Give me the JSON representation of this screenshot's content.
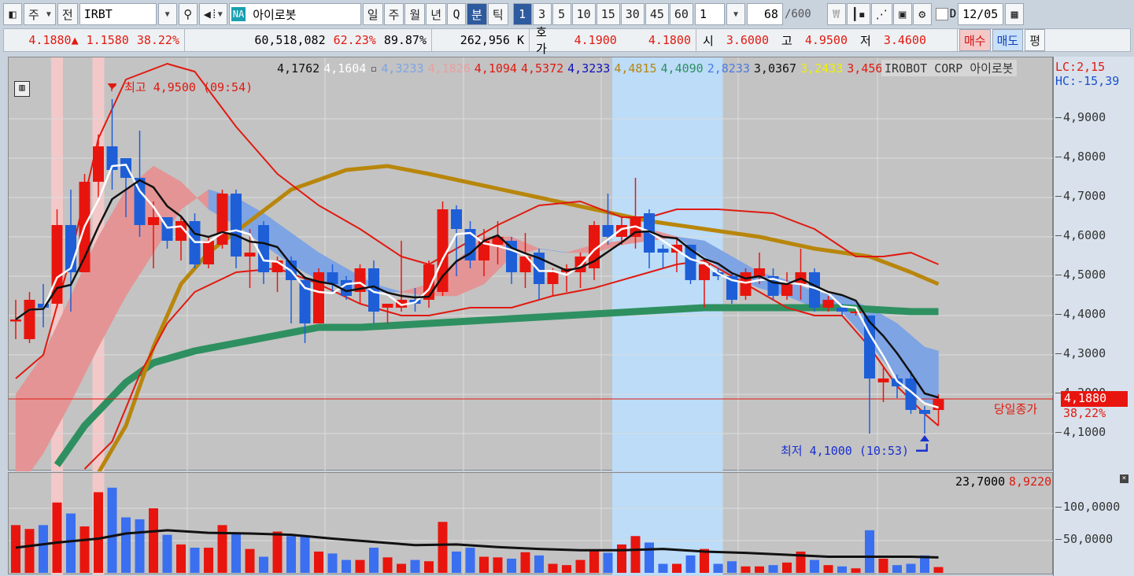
{
  "toolbar": {
    "period_type": "주",
    "jeon": "전",
    "symbol": "IRBT",
    "na_badge": "NA",
    "name": "아이로봇",
    "periods": [
      "일",
      "주",
      "월",
      "년",
      "Q",
      "분",
      "틱"
    ],
    "active_period": "분",
    "intervals": [
      "1",
      "3",
      "5",
      "10",
      "15",
      "30",
      "45",
      "60"
    ],
    "active_interval": "1",
    "custom_interval": "1",
    "count": "68",
    "count_max": "/600",
    "d_label": "D",
    "date": "12/05"
  },
  "quote": {
    "price": "4.1880▲",
    "change": "1.1580",
    "change_pct": "38.22%",
    "volume": "60,518,082",
    "vol_pct1": "62.23%",
    "vol_pct2": "89.87%",
    "amount": "262,956 K",
    "hoga_label": "호가",
    "ask": "4.1900",
    "bid": "4.1800",
    "open_label": "시",
    "open": "3.6000",
    "high_label": "고",
    "high": "4.9500",
    "low_label": "저",
    "low": "3.4600",
    "buy": "매수",
    "sell": "매도",
    "avg": "평"
  },
  "legend": [
    {
      "t": "4,1762",
      "c": "#111111"
    },
    {
      "t": "4,1604",
      "c": "#ffffff"
    },
    {
      "t": "▫",
      "c": "#555555"
    },
    {
      "t": "4,3233",
      "c": "#7ea4e4"
    },
    {
      "t": "4,1826",
      "c": "#e8a0a0"
    },
    {
      "t": "4,1094",
      "c": "#e01a10"
    },
    {
      "t": "4,5372",
      "c": "#e01a10"
    },
    {
      "t": "4,3233",
      "c": "#1010c0"
    },
    {
      "t": "4,4815",
      "c": "#b8860b"
    },
    {
      "t": "4,4090",
      "c": "#2e9060"
    },
    {
      "t": "2,8233",
      "c": "#4a7ae0"
    },
    {
      "t": "3,0367",
      "c": "#111111"
    },
    {
      "t": "3,2433",
      "c": "#f0f000"
    },
    {
      "t": "3,4567",
      "c": "#e01a10"
    },
    {
      "t": "▫",
      "c": "#555555"
    }
  ],
  "legend_name": "IROBOT CORP  아이로봇",
  "lc": "LC:2,15",
  "hc": "HC:-15,39",
  "close_label": "당일종가",
  "close_value": "4,1880",
  "close_pct": "38,22%",
  "high_marker": "최고 4,9500 (09:54)",
  "low_marker": "최저 4,1000 (10:53)",
  "vol_legend": {
    "a": "23,7000",
    "b": "8,9220"
  },
  "colors": {
    "up": "#e8150e",
    "down": "#1e5fd8",
    "vol_down": "#3a6ff0"
  },
  "chart_data": {
    "type": "candlestick",
    "price_axis": {
      "ticks": [
        4.1,
        4.2,
        4.3,
        4.4,
        4.5,
        4.6,
        4.7,
        4.8,
        4.9
      ],
      "labels": [
        "4,1000",
        "4,2000",
        "4,3000",
        "4,4000",
        "4,5000",
        "4,6000",
        "4,7000",
        "4,8000",
        "4,9000"
      ]
    },
    "volume_axis": {
      "ticks": [
        50,
        100
      ],
      "labels": [
        "50,0000",
        "100,0000"
      ]
    },
    "ohlc": [
      [
        4.385,
        4.44,
        4.34,
        4.39
      ],
      [
        4.34,
        4.46,
        4.33,
        4.44
      ],
      [
        4.43,
        4.48,
        4.37,
        4.42
      ],
      [
        4.43,
        4.67,
        4.42,
        4.63
      ],
      [
        4.63,
        4.72,
        4.41,
        4.51
      ],
      [
        4.51,
        4.76,
        4.51,
        4.74
      ],
      [
        4.74,
        4.86,
        4.7,
        4.83
      ],
      [
        4.83,
        4.95,
        4.72,
        4.77
      ],
      [
        4.8,
        4.8,
        4.65,
        4.75
      ],
      [
        4.75,
        4.87,
        4.6,
        4.63
      ],
      [
        4.63,
        4.69,
        4.52,
        4.65
      ],
      [
        4.65,
        4.65,
        4.57,
        4.59
      ],
      [
        4.59,
        4.65,
        4.54,
        4.64
      ],
      [
        4.64,
        4.66,
        4.52,
        4.53
      ],
      [
        4.53,
        4.6,
        4.52,
        4.59
      ],
      [
        4.58,
        4.72,
        4.57,
        4.71
      ],
      [
        4.71,
        4.72,
        4.52,
        4.55
      ],
      [
        4.55,
        4.62,
        4.47,
        4.56
      ],
      [
        4.63,
        4.64,
        4.48,
        4.51
      ],
      [
        4.51,
        4.55,
        4.46,
        4.54
      ],
      [
        4.54,
        4.55,
        4.38,
        4.49
      ],
      [
        4.49,
        4.5,
        4.33,
        4.38
      ],
      [
        4.38,
        4.52,
        4.38,
        4.51
      ],
      [
        4.51,
        4.53,
        4.46,
        4.48
      ],
      [
        4.49,
        4.5,
        4.44,
        4.45
      ],
      [
        4.46,
        4.53,
        4.43,
        4.52
      ],
      [
        4.52,
        4.54,
        4.38,
        4.41
      ],
      [
        4.42,
        4.43,
        4.38,
        4.43
      ],
      [
        4.42,
        4.59,
        4.41,
        4.44
      ],
      [
        4.44,
        4.47,
        4.41,
        4.43
      ],
      [
        4.44,
        4.54,
        4.42,
        4.53
      ],
      [
        4.46,
        4.69,
        4.45,
        4.67
      ],
      [
        4.67,
        4.68,
        4.5,
        4.62
      ],
      [
        4.62,
        4.64,
        4.52,
        4.54
      ],
      [
        4.54,
        4.62,
        4.5,
        4.59
      ],
      [
        4.58,
        4.64,
        4.53,
        4.6
      ],
      [
        4.59,
        4.6,
        4.48,
        4.51
      ],
      [
        4.51,
        4.61,
        4.47,
        4.55
      ],
      [
        4.56,
        4.57,
        4.44,
        4.48
      ],
      [
        4.48,
        4.52,
        4.45,
        4.51
      ],
      [
        4.51,
        4.53,
        4.46,
        4.52
      ],
      [
        4.51,
        4.56,
        4.47,
        4.55
      ],
      [
        4.52,
        4.64,
        4.49,
        4.63
      ],
      [
        4.63,
        4.71,
        4.58,
        4.6
      ],
      [
        4.6,
        4.65,
        4.58,
        4.63
      ],
      [
        4.6,
        4.75,
        4.57,
        4.65
      ],
      [
        4.66,
        4.67,
        4.52,
        4.56
      ],
      [
        4.57,
        4.58,
        4.52,
        4.56
      ],
      [
        4.56,
        4.6,
        4.51,
        4.58
      ],
      [
        4.58,
        4.58,
        4.48,
        4.49
      ],
      [
        4.49,
        4.54,
        4.42,
        4.53
      ],
      [
        4.51,
        4.52,
        4.49,
        4.5
      ],
      [
        4.5,
        4.51,
        4.43,
        4.44
      ],
      [
        4.45,
        4.52,
        4.44,
        4.51
      ],
      [
        4.5,
        4.56,
        4.48,
        4.52
      ],
      [
        4.5,
        4.52,
        4.44,
        4.45
      ],
      [
        4.45,
        4.51,
        4.44,
        4.48
      ],
      [
        4.48,
        4.57,
        4.44,
        4.51
      ],
      [
        4.51,
        4.52,
        4.41,
        4.42
      ],
      [
        4.42,
        4.45,
        4.41,
        4.44
      ],
      [
        4.42,
        4.43,
        4.4,
        4.41
      ],
      [
        4.41,
        4.42,
        4.4,
        4.41
      ],
      [
        4.4,
        4.4,
        4.1,
        4.24
      ],
      [
        4.23,
        4.27,
        4.18,
        4.24
      ],
      [
        4.24,
        4.25,
        4.19,
        4.22
      ],
      [
        4.24,
        4.26,
        4.15,
        4.16
      ],
      [
        4.16,
        4.17,
        4.1,
        4.15
      ],
      [
        4.16,
        4.2,
        4.12,
        4.188
      ]
    ],
    "volume": [
      74,
      68,
      74,
      109,
      92,
      72,
      125,
      132,
      86,
      83,
      100,
      59,
      44,
      39,
      39,
      74,
      63,
      37,
      25,
      64,
      57,
      57,
      33,
      30,
      20,
      20,
      39,
      24,
      14,
      20,
      18,
      79,
      33,
      39,
      25,
      24,
      22,
      32,
      27,
      14,
      12,
      20,
      34,
      31,
      44,
      57,
      47,
      14,
      14,
      27,
      37,
      14,
      18,
      10,
      10,
      12,
      16,
      33,
      20,
      12,
      10,
      7,
      66,
      22,
      12,
      14,
      27,
      9
    ],
    "volume_ma": [
      [
        0,
        39
      ],
      [
        3,
        47
      ],
      [
        6,
        53
      ],
      [
        8,
        61
      ],
      [
        11,
        66
      ],
      [
        14,
        62
      ],
      [
        17,
        61
      ],
      [
        20,
        59
      ],
      [
        23,
        53
      ],
      [
        26,
        48
      ],
      [
        29,
        43
      ],
      [
        32,
        44
      ],
      [
        35,
        40
      ],
      [
        38,
        37
      ],
      [
        41,
        35
      ],
      [
        44,
        35
      ],
      [
        47,
        37
      ],
      [
        50,
        33
      ],
      [
        53,
        31
      ],
      [
        56,
        28
      ],
      [
        59,
        25
      ],
      [
        62,
        25
      ],
      [
        65,
        25
      ],
      [
        67,
        24
      ]
    ],
    "band_upper": [
      [
        0,
        4.24
      ],
      [
        2,
        4.3
      ],
      [
        4,
        4.55
      ],
      [
        6,
        4.85
      ],
      [
        8,
        5.0
      ],
      [
        11,
        5.04
      ],
      [
        13,
        5.02
      ],
      [
        16,
        4.88
      ],
      [
        19,
        4.76
      ],
      [
        22,
        4.68
      ],
      [
        25,
        4.62
      ],
      [
        28,
        4.55
      ],
      [
        30,
        4.53
      ],
      [
        32,
        4.57
      ],
      [
        35,
        4.63
      ],
      [
        38,
        4.68
      ],
      [
        41,
        4.69
      ],
      [
        44,
        4.65
      ],
      [
        46,
        4.65
      ],
      [
        48,
        4.67
      ],
      [
        51,
        4.67
      ],
      [
        55,
        4.66
      ],
      [
        58,
        4.62
      ],
      [
        61,
        4.55
      ],
      [
        63,
        4.55
      ],
      [
        65,
        4.56
      ],
      [
        67,
        4.53
      ]
    ],
    "band_lower": [
      [
        5,
        4.01
      ],
      [
        7,
        4.08
      ],
      [
        9,
        4.25
      ],
      [
        11,
        4.38
      ],
      [
        13,
        4.46
      ],
      [
        16,
        4.51
      ],
      [
        19,
        4.52
      ],
      [
        22,
        4.48
      ],
      [
        25,
        4.43
      ],
      [
        28,
        4.4
      ],
      [
        30,
        4.4
      ],
      [
        33,
        4.42
      ],
      [
        36,
        4.42
      ],
      [
        39,
        4.45
      ],
      [
        42,
        4.47
      ],
      [
        45,
        4.5
      ],
      [
        48,
        4.53
      ],
      [
        50,
        4.54
      ],
      [
        53,
        4.48
      ],
      [
        56,
        4.42
      ],
      [
        58,
        4.4
      ],
      [
        60,
        4.4
      ],
      [
        62,
        4.32
      ],
      [
        64,
        4.22
      ],
      [
        66,
        4.15
      ],
      [
        67,
        4.12
      ]
    ],
    "ma_gold": [
      [
        6,
        4.0
      ],
      [
        8,
        4.12
      ],
      [
        10,
        4.32
      ],
      [
        12,
        4.48
      ],
      [
        14,
        4.56
      ],
      [
        17,
        4.64
      ],
      [
        20,
        4.72
      ],
      [
        24,
        4.77
      ],
      [
        27,
        4.78
      ],
      [
        30,
        4.76
      ],
      [
        34,
        4.73
      ],
      [
        38,
        4.7
      ],
      [
        42,
        4.67
      ],
      [
        46,
        4.64
      ],
      [
        50,
        4.62
      ],
      [
        54,
        4.6
      ],
      [
        58,
        4.57
      ],
      [
        62,
        4.55
      ],
      [
        65,
        4.51
      ],
      [
        67,
        4.48
      ]
    ],
    "ma_green": [
      [
        3,
        4.02
      ],
      [
        5,
        4.12
      ],
      [
        8,
        4.23
      ],
      [
        10,
        4.28
      ],
      [
        13,
        4.31
      ],
      [
        16,
        4.33
      ],
      [
        19,
        4.35
      ],
      [
        22,
        4.37
      ],
      [
        25,
        4.37
      ],
      [
        30,
        4.38
      ],
      [
        35,
        4.39
      ],
      [
        40,
        4.4
      ],
      [
        45,
        4.41
      ],
      [
        50,
        4.42
      ],
      [
        55,
        4.42
      ],
      [
        60,
        4.42
      ],
      [
        65,
        4.41
      ],
      [
        67,
        4.41
      ]
    ],
    "cloud_idx": [
      0,
      2,
      4,
      6,
      8,
      10,
      12,
      14,
      16,
      18,
      20,
      22,
      24,
      26,
      28,
      30,
      32,
      34,
      36,
      38,
      40,
      42,
      44,
      46,
      48,
      50,
      52,
      54,
      56,
      58,
      60,
      62,
      64,
      66,
      67
    ],
    "cloud_a": [
      4.2,
      4.3,
      4.45,
      4.6,
      4.72,
      4.78,
      4.74,
      4.67,
      4.63,
      4.58,
      4.53,
      4.49,
      4.47,
      4.46,
      4.46,
      4.48,
      4.54,
      4.6,
      4.6,
      4.57,
      4.56,
      4.58,
      4.59,
      4.62,
      4.6,
      4.55,
      4.5,
      4.47,
      4.45,
      4.42,
      4.41,
      4.33,
      4.24,
      4.18,
      4.17
    ],
    "cloud_b": [
      3.95,
      4.05,
      4.18,
      4.32,
      4.45,
      4.56,
      4.67,
      4.72,
      4.7,
      4.66,
      4.61,
      4.56,
      4.52,
      4.48,
      4.46,
      4.45,
      4.45,
      4.48,
      4.55,
      4.57,
      4.56,
      4.56,
      4.58,
      4.59,
      4.6,
      4.59,
      4.55,
      4.51,
      4.49,
      4.46,
      4.45,
      4.42,
      4.38,
      4.32,
      4.31
    ],
    "close_line": 4.188,
    "high_point": {
      "index": 7,
      "price": 4.95
    },
    "low_point": {
      "index": 66,
      "price": 4.1
    },
    "highlight_pink": [
      3,
      6
    ],
    "highlight_blue": [
      44,
      51
    ]
  }
}
